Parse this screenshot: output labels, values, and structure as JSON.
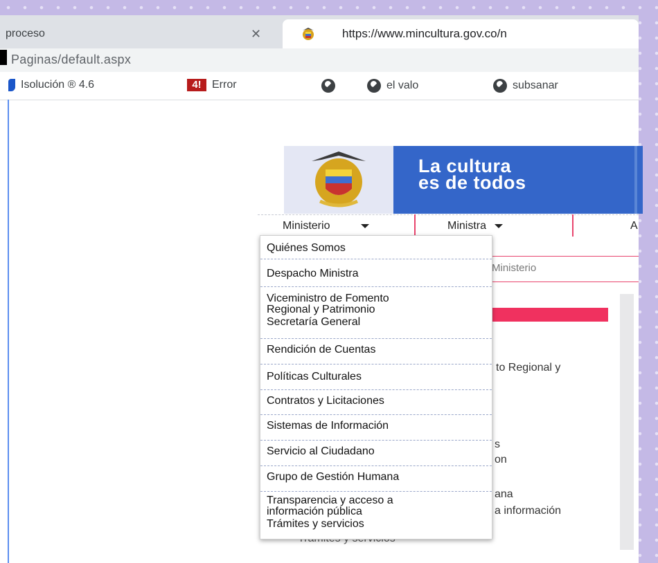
{
  "browser": {
    "tabs": [
      {
        "label": "proceso",
        "close": "✕"
      },
      {
        "label": "https://www.mincultura.gov.co/n"
      }
    ],
    "url": "Paginas/default.aspx",
    "bookmarks": [
      {
        "label": "Isolución ® 4.6",
        "icon": "isolucion-icon"
      },
      {
        "label": "Error",
        "icon": "error-logo-icon",
        "icon_text": "4!"
      },
      {
        "label": "",
        "icon": "globe-icon"
      },
      {
        "label": "el valo",
        "icon": "globe-icon"
      },
      {
        "label": "subsanar",
        "icon": "globe-icon"
      }
    ]
  },
  "header": {
    "slogan_line1": "La cultura",
    "slogan_line2": "es de todos"
  },
  "nav": {
    "items": [
      {
        "label": "Ministerio"
      },
      {
        "label": "Ministra"
      },
      {
        "label": "A"
      }
    ],
    "subnav_text": "Ministerio"
  },
  "dropdown": {
    "items": [
      {
        "line1": "Quiénes Somos"
      },
      {
        "line1": "Despacho Ministra"
      },
      {
        "line1": "Viceministro de Fomento",
        "line2": "Regional y Patrimonio"
      },
      {
        "line1": "Secretaría General"
      },
      {
        "line1": "Rendición de Cuentas"
      },
      {
        "line1": "Políticas Culturales"
      },
      {
        "line1": "Contratos y Licitaciones"
      },
      {
        "line1": "Sistemas de Información"
      },
      {
        "line1": "Servicio al Ciudadano"
      },
      {
        "line1": "Grupo de Gestión Humana"
      },
      {
        "line1": "Transparencia y acceso a",
        "line2": "información pública"
      },
      {
        "line1": "Trámites y servicios"
      }
    ]
  },
  "page_fragments": {
    "regional": "to Regional y",
    "s": "s",
    "on": "on",
    "ana": "ana",
    "informacion": "a información",
    "tramites": "Trámites y servicios"
  },
  "colors": {
    "brand_blue": "#3466c9",
    "accent_pink": "#f0315f"
  }
}
